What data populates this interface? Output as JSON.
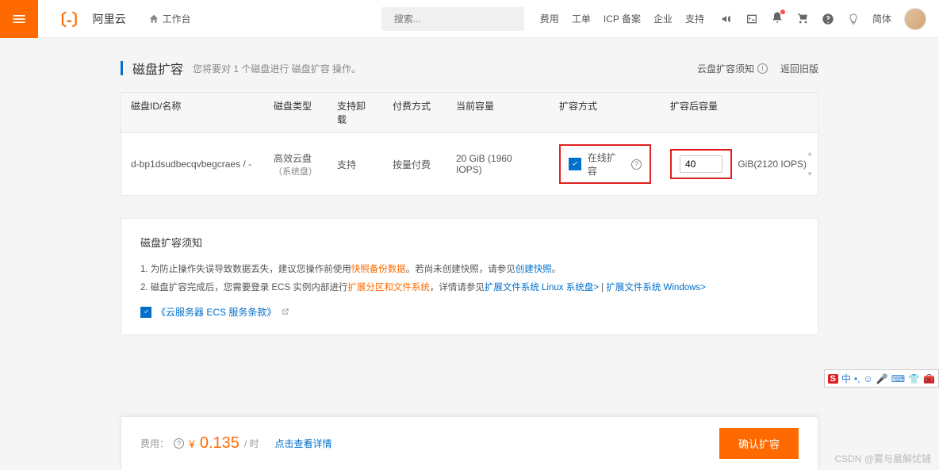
{
  "header": {
    "logo": "阿里云",
    "workbench": "工作台",
    "search_placeholder": "搜索...",
    "nav": {
      "fee": "费用",
      "ticket": "工单",
      "icp": "ICP 备案",
      "enterprise": "企业",
      "support": "支持"
    },
    "lang": "简体"
  },
  "page": {
    "title": "磁盘扩容",
    "subtitle": "您将要对 1 个磁盘进行 磁盘扩容 操作。",
    "notice_link": "云盘扩容须知",
    "old_version": "返回旧版"
  },
  "table": {
    "headers": {
      "id": "磁盘ID/名称",
      "type": "磁盘类型",
      "detach": "支持卸载",
      "billing": "付费方式",
      "current": "当前容量",
      "method": "扩容方式",
      "target": "扩容后容量"
    },
    "row": {
      "id": "d-bp1dsudbecqvbegcraes / -",
      "type": "高效云盘",
      "type_tag": "（系统盘）",
      "detach": "支持",
      "billing": "按量付费",
      "current": "20 GiB (1960 IOPS)",
      "method": "在线扩容",
      "target_value": "40",
      "target_suffix": "GiB(2120 IOPS)"
    }
  },
  "notice": {
    "title": "磁盘扩容须知",
    "item1_a": "1. 为防止操作失误导致数据丢失，建议您操作前使用",
    "item1_link1": "快照备份数据",
    "item1_b": "。若尚未创建快照，请参见",
    "item1_link2": "创建快照",
    "item1_c": "。",
    "item2_a": "2. 磁盘扩容完成后，您需要登录 ECS 实例内部进行",
    "item2_link1": "扩展分区和文件系统",
    "item2_b": "，详情请参见",
    "item2_link2": "扩展文件系统 Linux 系统盘>",
    "item2_sep": " | ",
    "item2_link3": "扩展文件系统 Windows>",
    "tos": "《云服务器 ECS 服务条款》"
  },
  "footer": {
    "fee_label": "费用：",
    "currency": "¥",
    "price": "0.135",
    "unit": "/ 时",
    "detail": "点击查看详情",
    "confirm": "确认扩容"
  },
  "watermark": "CSDN @雾与晨解忧铺",
  "ime": {
    "s": "S",
    "zh": "中"
  }
}
